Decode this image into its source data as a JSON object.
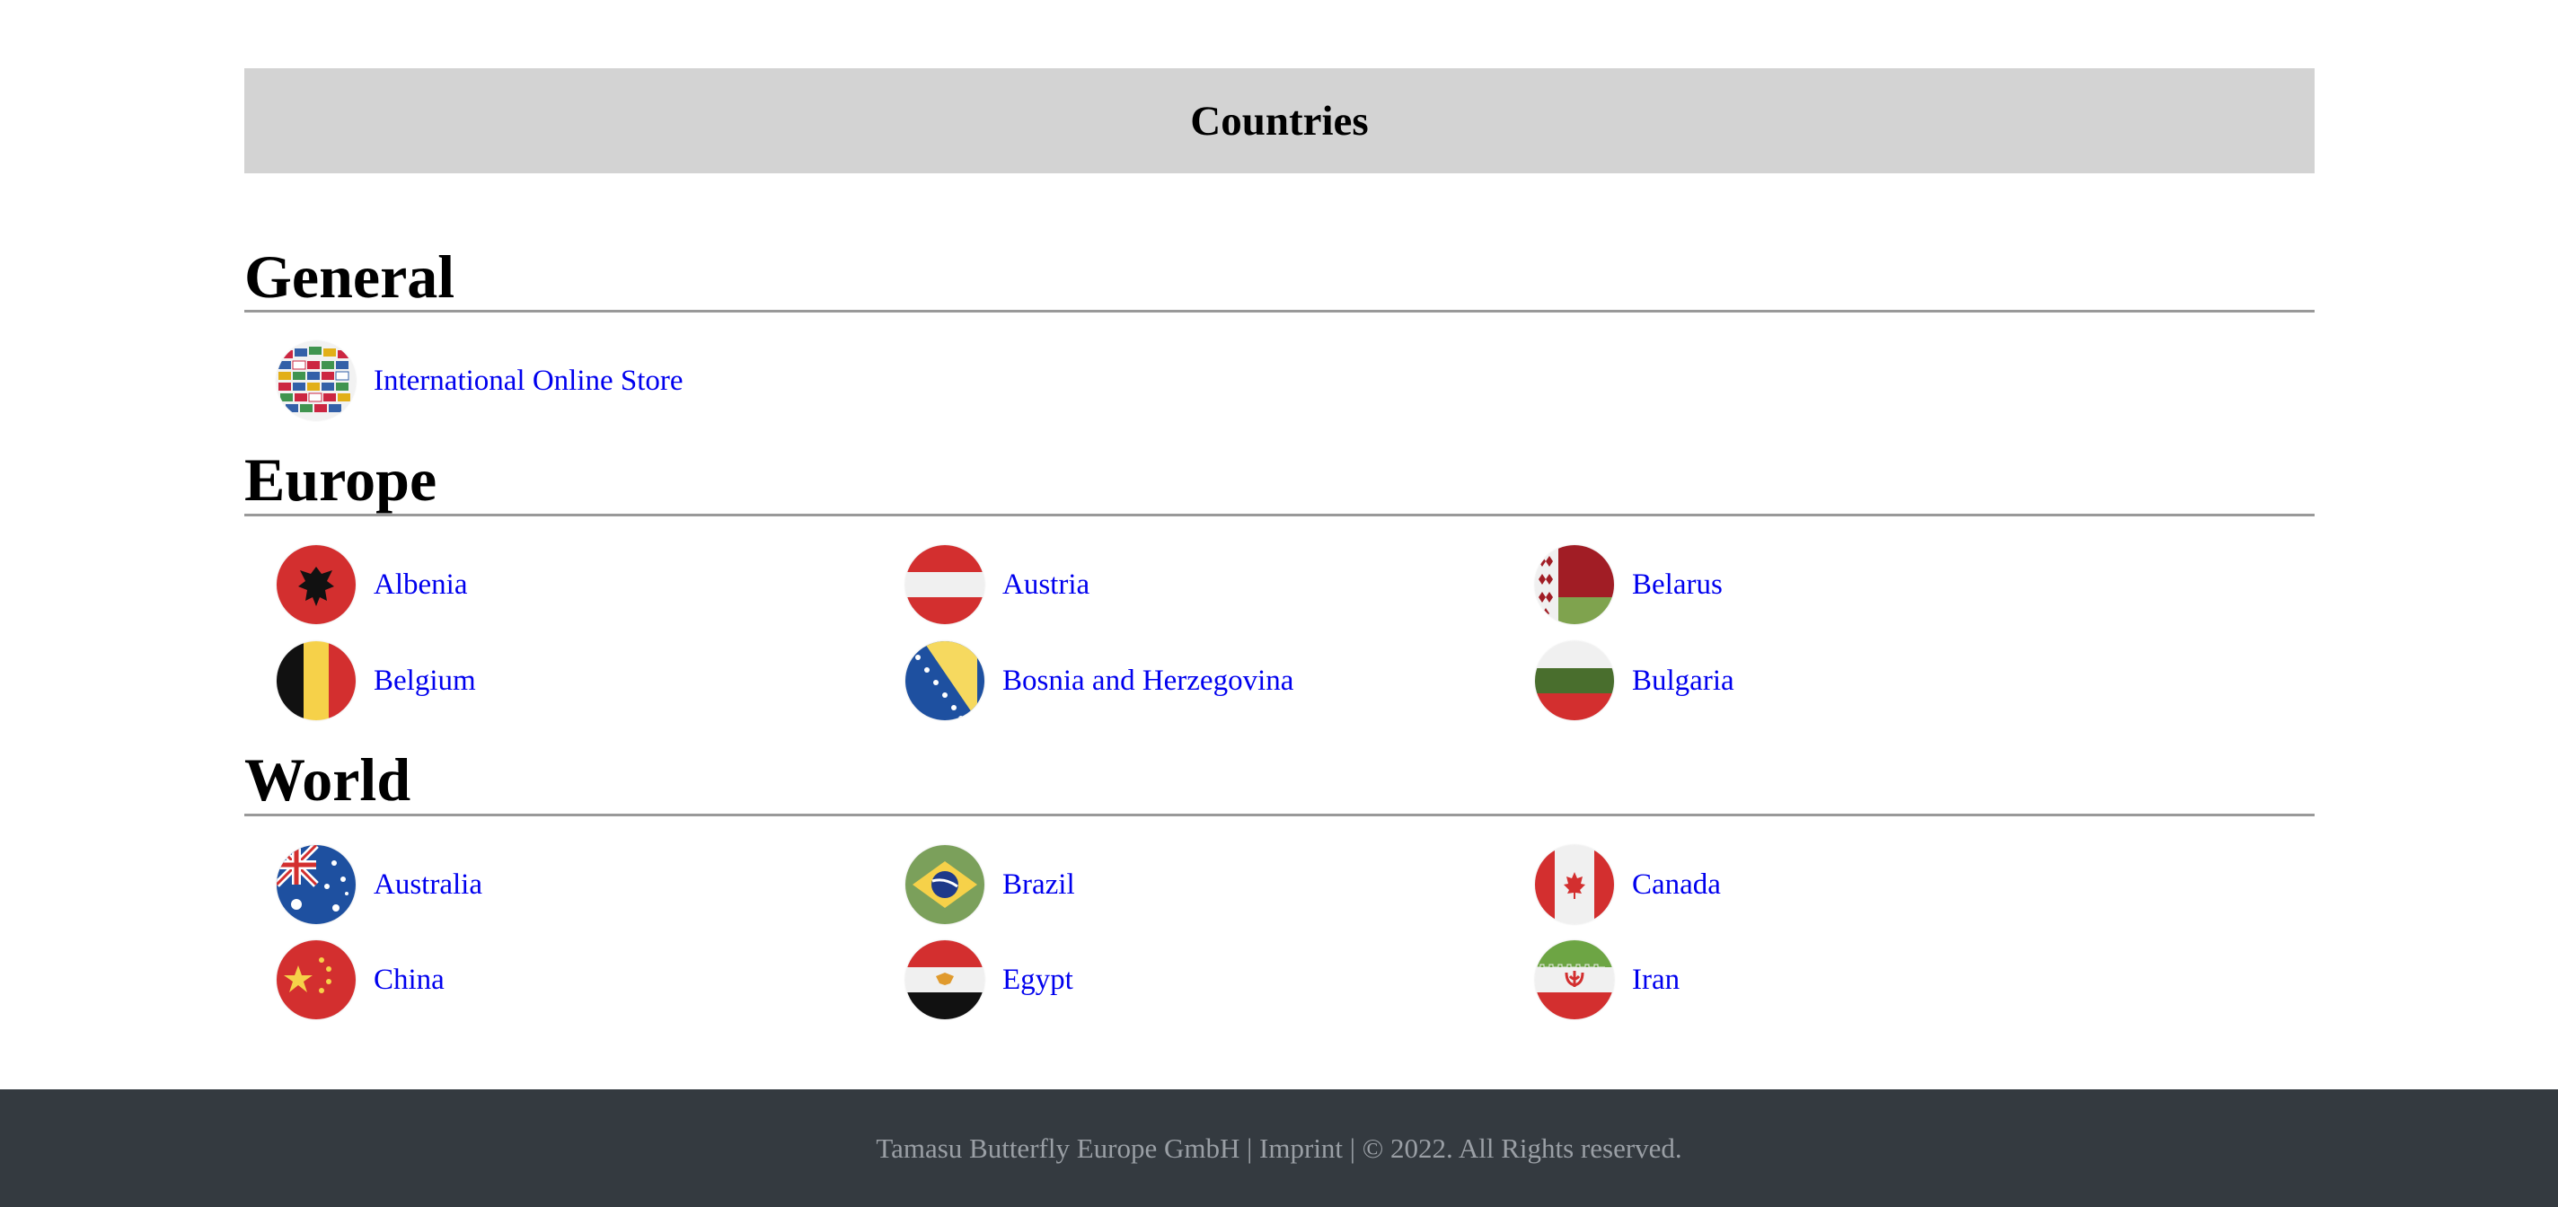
{
  "header": {
    "title": "Countries"
  },
  "sections": {
    "general": {
      "title": "General",
      "items": [
        {
          "label": "International Online Store",
          "icon": "globe-flags-icon"
        }
      ]
    },
    "europe": {
      "title": "Europe",
      "items": [
        {
          "label": "Albenia",
          "icon": "albania-flag-icon"
        },
        {
          "label": "Austria",
          "icon": "austria-flag-icon"
        },
        {
          "label": "Belarus",
          "icon": "belarus-flag-icon"
        },
        {
          "label": "Belgium",
          "icon": "belgium-flag-icon"
        },
        {
          "label": "Bosnia and Herzegovina",
          "icon": "bosnia-flag-icon"
        },
        {
          "label": "Bulgaria",
          "icon": "bulgaria-flag-icon"
        }
      ]
    },
    "world": {
      "title": "World",
      "items": [
        {
          "label": "Australia",
          "icon": "australia-flag-icon"
        },
        {
          "label": "Brazil",
          "icon": "brazil-flag-icon"
        },
        {
          "label": "Canada",
          "icon": "canada-flag-icon"
        },
        {
          "label": "China",
          "icon": "china-flag-icon"
        },
        {
          "label": "Egypt",
          "icon": "egypt-flag-icon"
        },
        {
          "label": "Iran",
          "icon": "iran-flag-icon"
        }
      ]
    }
  },
  "footer": {
    "text": "Tamasu Butterfly Europe GmbH | Imprint | © 2022. All Rights reserved."
  },
  "colors": {
    "link": "#0000ee",
    "header_bg": "#d3d3d3",
    "footer_bg": "#343a40",
    "footer_text": "#9a9fa5"
  }
}
